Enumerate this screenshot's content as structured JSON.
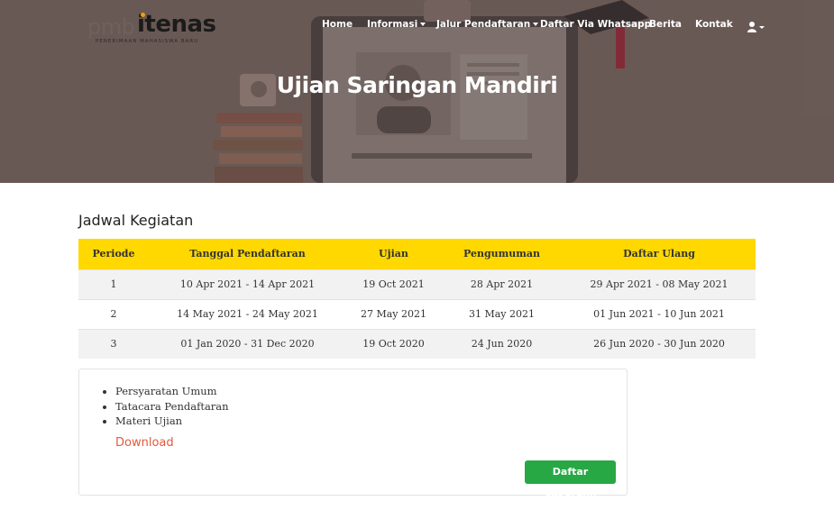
{
  "brand": {
    "logo_left": "pmb",
    "logo_right": "itenas",
    "logo_sub": "PENERIMAAN MAHASISWA BARU"
  },
  "nav": {
    "home": "Home",
    "informasi": "Informasi",
    "jalur": "Jalur Pendaftaran",
    "whatsapp": "Daftar Via Whatsapp",
    "berita": "Berita",
    "kontak": "Kontak"
  },
  "hero": {
    "title": "Ujian Saringan Mandiri"
  },
  "schedule": {
    "title": "Jadwal Kegiatan",
    "headers": [
      "Periode",
      "Tanggal Pendaftaran",
      "Ujian",
      "Pengumuman",
      "Daftar Ulang"
    ],
    "rows": [
      [
        "1",
        "10 Apr 2021 - 14 Apr 2021",
        "19 Oct 2021",
        "28 Apr 2021",
        "29 Apr 2021 - 08 May 2021"
      ],
      [
        "2",
        "14 May 2021 - 24 May 2021",
        "27 May 2021",
        "31 May 2021",
        "01 Jun 2021 - 10 Jun 2021"
      ],
      [
        "3",
        "01 Jan 2020 - 31 Dec 2020",
        "19 Oct 2020",
        "24 Jun 2020",
        "26 Jun 2020 - 30 Jun 2020"
      ]
    ]
  },
  "info": {
    "items": [
      "Persyaratan Umum",
      "Tatacara Pendaftaran",
      "Materi Ujian"
    ],
    "download": "Download",
    "register_button": "Daftar Sekarang"
  },
  "colors": {
    "table_header": "#ffd800",
    "download_link": "#e25a3a",
    "register_button": "#28a745"
  }
}
